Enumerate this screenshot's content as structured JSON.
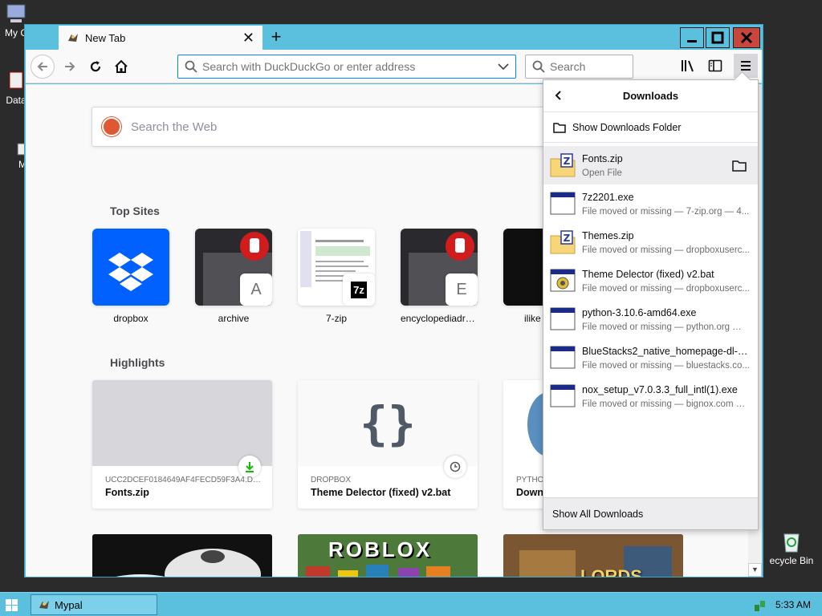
{
  "desktop": {
    "icons": [
      {
        "label": "My C"
      },
      {
        "label": "Data"
      },
      {
        "label": "M"
      },
      {
        "label": "ecycle Bin"
      }
    ]
  },
  "browser": {
    "tab": {
      "title": "New Tab",
      "close": "✕"
    },
    "new_tab": "+",
    "url_placeholder": "Search with DuckDuckGo or enter address",
    "search_placeholder": "Search"
  },
  "newtab": {
    "web_search_placeholder": "Search the Web",
    "top_sites_title": "Top Sites",
    "top_sites": [
      {
        "label": "dropbox",
        "badge": ""
      },
      {
        "label": "archive",
        "badge": "A"
      },
      {
        "label": "7-zip",
        "badge": "7z"
      },
      {
        "label": "encyclopediadra...",
        "badge": "E"
      },
      {
        "label": "ilike",
        "badge": ""
      }
    ],
    "highlights_title": "Highlights",
    "highlights": [
      {
        "source": "UCC2DCEF0184649AF4FECD59F3A4.DL.DR...",
        "title": "Fonts.zip"
      },
      {
        "source": "DROPBOX",
        "title": "Theme Delector (fixed) v2.bat",
        "thumb_glyph": "{}"
      },
      {
        "source": "PYTHO",
        "title": "Down"
      }
    ],
    "roblox_text": "ROBLOX",
    "lords_text": "LORDS"
  },
  "downloads": {
    "title": "Downloads",
    "show_folder": "Show Downloads Folder",
    "items": [
      {
        "name": "Fonts.zip",
        "status": "Open File",
        "icon": "zip-folder"
      },
      {
        "name": "7z2201.exe",
        "status": "File moved or missing — 7-zip.org — 4...",
        "icon": "exe-window"
      },
      {
        "name": "Themes.zip",
        "status": "File moved or missing — dropboxuserc...",
        "icon": "zip-folder"
      },
      {
        "name": "Theme Delector (fixed) v2.bat",
        "status": "File moved or missing — dropboxuserc...",
        "icon": "bat-gear"
      },
      {
        "name": "python-3.10.6-amd64.exe",
        "status": "File moved or missing — python.org — ...",
        "icon": "exe-window"
      },
      {
        "name": "BlueStacks2_native_homepage-dl-but...",
        "status": "File moved or missing — bluestacks.co...",
        "icon": "exe-window"
      },
      {
        "name": "nox_setup_v7.0.3.3_full_intl(1).exe",
        "status": "File moved or missing — bignox.com — ...",
        "icon": "exe-window"
      }
    ],
    "show_all": "Show All Downloads"
  },
  "taskbar": {
    "task_label": "Mypal",
    "clock": "5:33 AM"
  },
  "colors": {
    "accent": "#5bc0de",
    "close_button": "#c9463d",
    "url_focus": "#0a84ff",
    "dropbox": "#0061fe"
  }
}
